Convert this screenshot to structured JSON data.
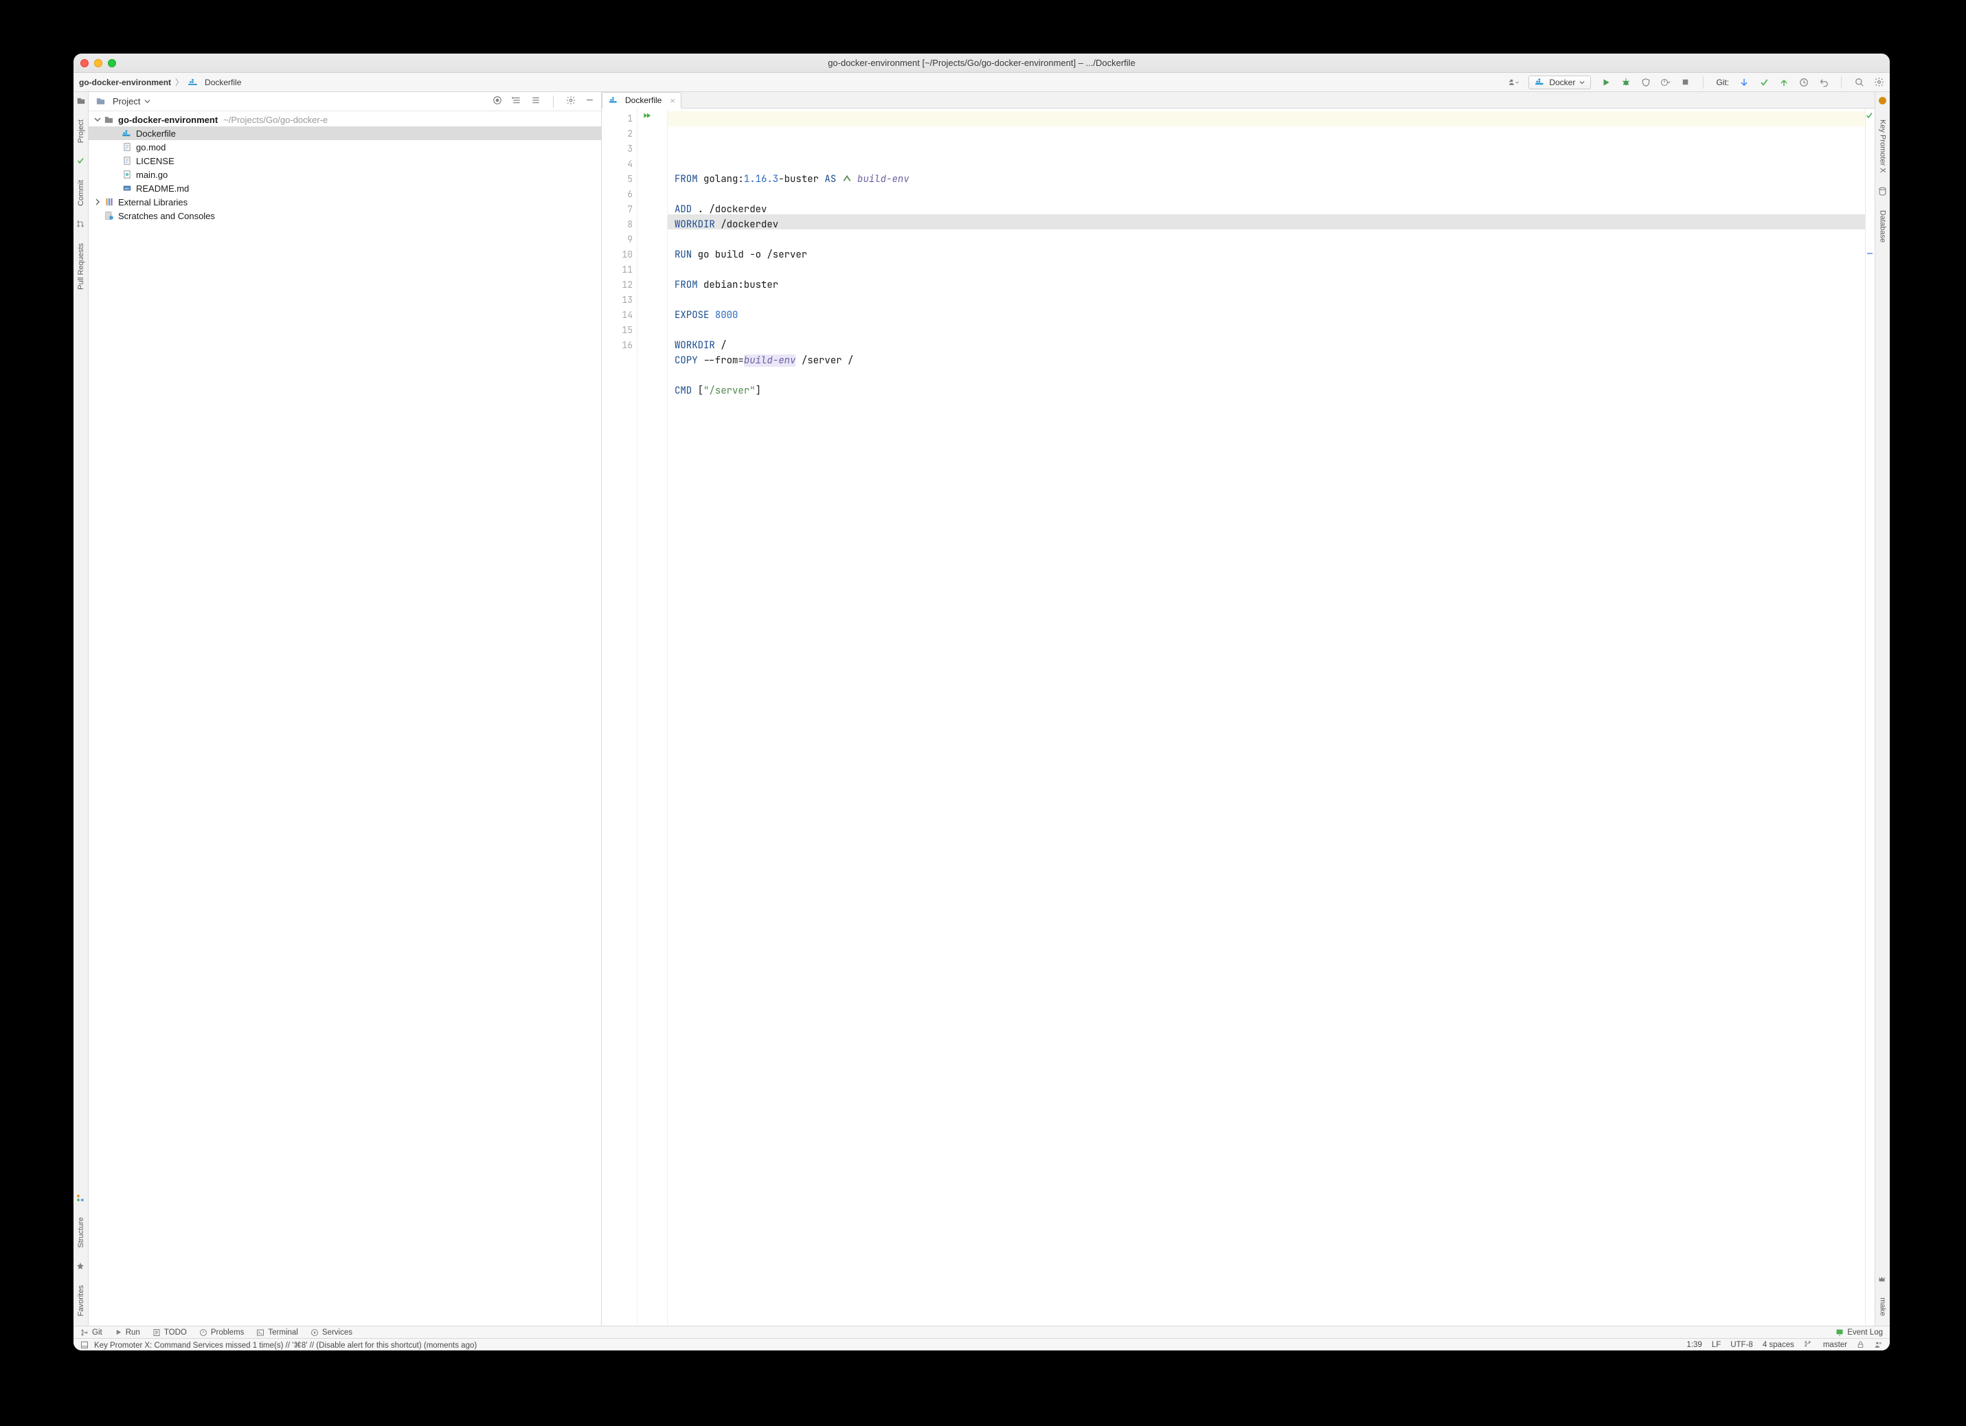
{
  "window": {
    "title": "go-docker-environment [~/Projects/Go/go-docker-environment] – .../Dockerfile"
  },
  "breadcrumb": {
    "project": "go-docker-environment",
    "file": "Dockerfile"
  },
  "runconfig": {
    "label": "Docker"
  },
  "git_label": "Git:",
  "project_panel": {
    "title": "Project"
  },
  "tree": {
    "root": {
      "name": "go-docker-environment",
      "path": "~/Projects/Go/go-docker-e"
    },
    "files": [
      {
        "name": "Dockerfile",
        "selected": true,
        "icon": "docker"
      },
      {
        "name": "go.mod",
        "icon": "text"
      },
      {
        "name": "LICENSE",
        "icon": "text"
      },
      {
        "name": "main.go",
        "icon": "go"
      },
      {
        "name": "README.md",
        "icon": "md"
      }
    ],
    "external_libraries": "External Libraries",
    "scratches": "Scratches and Consoles"
  },
  "tab": {
    "label": "Dockerfile"
  },
  "code": {
    "lines": [
      {
        "n": 1,
        "seg": [
          [
            "kw",
            "FROM"
          ],
          [
            "",
            " golang:"
          ],
          [
            "num",
            "1.16.3"
          ],
          [
            "",
            "-buster "
          ],
          [
            "kw",
            "AS"
          ],
          [
            "",
            " "
          ],
          [
            "mark",
            ""
          ],
          [
            "",
            " "
          ],
          [
            "id-ital",
            "build-env"
          ]
        ]
      },
      {
        "n": 2,
        "seg": [
          [
            "",
            ""
          ]
        ]
      },
      {
        "n": 3,
        "seg": [
          [
            "kw",
            "ADD"
          ],
          [
            "",
            " . /dockerdev"
          ]
        ]
      },
      {
        "n": 4,
        "seg": [
          [
            "kw",
            "WORKDIR"
          ],
          [
            "",
            " /dockerdev"
          ]
        ]
      },
      {
        "n": 5,
        "seg": [
          [
            "",
            ""
          ]
        ]
      },
      {
        "n": 6,
        "seg": [
          [
            "kw",
            "RUN"
          ],
          [
            "",
            " go build -o /server"
          ]
        ]
      },
      {
        "n": 7,
        "seg": [
          [
            "",
            ""
          ]
        ]
      },
      {
        "n": 8,
        "seg": [
          [
            "kw",
            "FROM"
          ],
          [
            "",
            " debian:buster"
          ]
        ]
      },
      {
        "n": 9,
        "seg": [
          [
            "",
            ""
          ]
        ]
      },
      {
        "n": 10,
        "seg": [
          [
            "kw",
            "EXPOSE"
          ],
          [
            "",
            " "
          ],
          [
            "num",
            "8000"
          ]
        ]
      },
      {
        "n": 11,
        "seg": [
          [
            "",
            ""
          ]
        ]
      },
      {
        "n": 12,
        "seg": [
          [
            "kw",
            "WORKDIR"
          ],
          [
            "",
            " /"
          ]
        ]
      },
      {
        "n": 13,
        "seg": [
          [
            "kw",
            "COPY"
          ],
          [
            "",
            " --from="
          ],
          [
            "id-ital hl-box",
            "build-env"
          ],
          [
            "",
            " /server /"
          ]
        ]
      },
      {
        "n": 14,
        "seg": [
          [
            "",
            ""
          ]
        ]
      },
      {
        "n": 15,
        "seg": [
          [
            "kw",
            "CMD"
          ],
          [
            "",
            " ["
          ],
          [
            "str",
            "\"/server\""
          ],
          [
            "",
            "]"
          ]
        ]
      },
      {
        "n": 16,
        "seg": [
          [
            "",
            ""
          ]
        ]
      }
    ]
  },
  "left_rail": [
    "Project",
    "Commit",
    "Pull Requests"
  ],
  "left_rail_bottom": [
    "Structure",
    "Favorites"
  ],
  "right_rail": [
    "Key Promoter X",
    "Database"
  ],
  "right_rail_bottom": [
    "make"
  ],
  "bottombar": {
    "items": [
      "Git",
      "Run",
      "TODO",
      "Problems",
      "Terminal",
      "Services"
    ],
    "event_log": "Event Log"
  },
  "statusbar": {
    "msg": "Key Promoter X: Command Services missed 1 time(s) // '⌘8' // (Disable alert for this shortcut) (moments ago)",
    "pos": "1:39",
    "le": "LF",
    "enc": "UTF-8",
    "indent": "4 spaces",
    "branch": "master"
  }
}
